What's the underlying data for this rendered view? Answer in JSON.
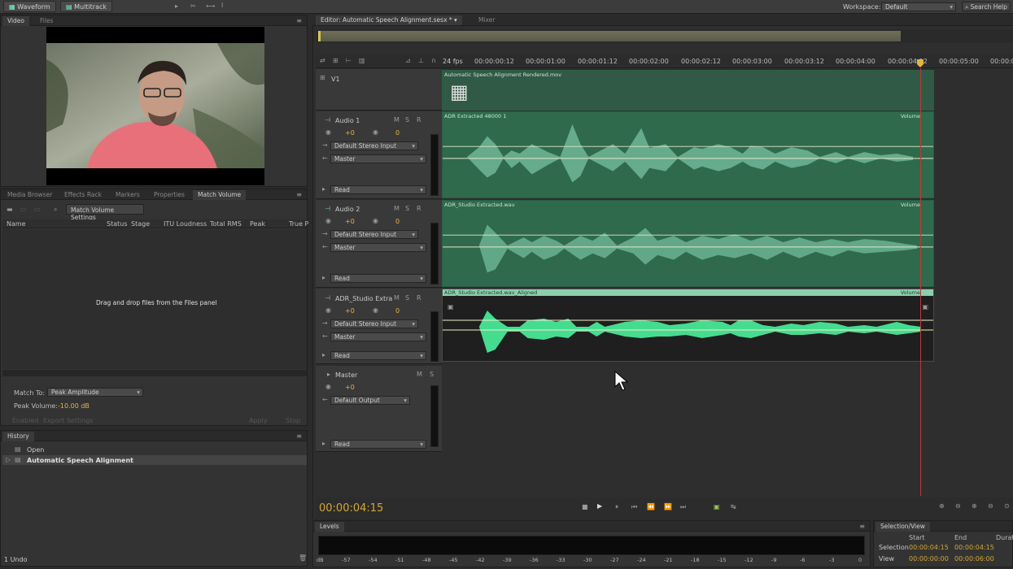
{
  "toolbar": {
    "waveform": "Waveform",
    "multitrack": "Multitrack",
    "workspace_label": "Workspace:",
    "workspace_value": "Default",
    "search": "Search Help"
  },
  "video_panel": {
    "tabs": [
      "Video",
      "Files"
    ]
  },
  "match_panel": {
    "tabs": [
      "Media Browser",
      "Effects Rack",
      "Markers",
      "Properties",
      "Match Volume"
    ],
    "settings_button": "Match Volume Settings",
    "columns": [
      "Name",
      "Status",
      "Stage",
      "ITU Loudness",
      "Total RMS",
      "Peak",
      "True P"
    ],
    "empty_msg": "Drag and drop files from the Files panel",
    "match_to_label": "Match To:",
    "match_to_value": "Peak Amplitude",
    "peak_label": "Peak Volume:",
    "peak_value": "-10.00 dB",
    "footer": [
      "Enabled",
      "Export Settings",
      "Apply",
      "Stop"
    ]
  },
  "history": {
    "title": "History",
    "items": [
      "Open",
      "Automatic Speech Alignment"
    ],
    "undo": "1 Undo"
  },
  "editor": {
    "tab": "Editor: Automatic Speech Alignment.sesx *",
    "mixer": "Mixer",
    "fps": "24 fps",
    "ticks": [
      "00:00:00:12",
      "00:00:01:00",
      "00:00:01:12",
      "00:00:02:00",
      "00:00:02:12",
      "00:00:03:00",
      "00:00:03:12",
      "00:00:04:00",
      "00:00:04:12",
      "00:00:05:00",
      "00:00:0"
    ]
  },
  "tracks": {
    "video": {
      "name": "V1",
      "clip": "Automatic Speech Alignment Rendered.mov"
    },
    "audio1": {
      "name": "Audio 1",
      "vol": "+0",
      "pan": "0",
      "input": "Default Stereo Input",
      "output": "Master",
      "mode": "Read",
      "clip": "ADR Extracted 48000 1",
      "volume": "Volume"
    },
    "audio2": {
      "name": "Audio 2",
      "vol": "+0",
      "pan": "0",
      "input": "Default Stereo Input",
      "output": "Master",
      "mode": "Read",
      "clip": "ADR_Studio Extracted.wav",
      "volume": "Volume"
    },
    "audio3": {
      "name": "ADR_Studio Extra",
      "vol": "+0",
      "pan": "0",
      "input": "Default Stereo Input",
      "output": "Master",
      "mode": "Read",
      "clip": "ADR_Studio Extracted.wav_Aligned",
      "volume": "Volume"
    },
    "master": {
      "name": "Master",
      "vol": "+0",
      "output": "Default Output",
      "mode": "Read"
    }
  },
  "transport": {
    "time": "00:00:04:15"
  },
  "levels": {
    "title": "Levels",
    "scale": [
      "dB",
      "-57",
      "-54",
      "-51",
      "-48",
      "-45",
      "-42",
      "-39",
      "-36",
      "-33",
      "-30",
      "-27",
      "-24",
      "-21",
      "-18",
      "-15",
      "-12",
      "-9",
      "-6",
      "-3",
      "0"
    ]
  },
  "selection_view": {
    "title": "Selection/View",
    "start": "Start",
    "end": "End",
    "duration": "Durat",
    "selection": "Selection",
    "view": "View",
    "sel_start": "00:00:04:15",
    "sel_end": "00:00:04:15",
    "view_start": "00:00:00:00",
    "view_end": "00:00:06:00"
  }
}
